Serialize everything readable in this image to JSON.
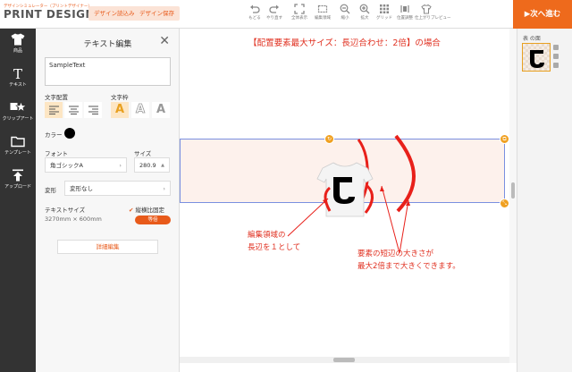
{
  "app": {
    "logo_sub": "デザインシミュレーター（プリントデザイナー）",
    "logo_main": "PRINT DESIGNER",
    "load_design": "デザイン読込み",
    "save_design": "デザイン保存",
    "next_button": "▶次へ進む"
  },
  "toolbar": {
    "undo": "もどる",
    "redo": "やり直す",
    "fit_all": "全体表示",
    "edit_area": "編集領域",
    "zoom_out": "縮小",
    "zoom_in": "拡大",
    "grid": "グリッド",
    "align_tool": "位置調整",
    "preview": "仕上がりプレビュー"
  },
  "sidebar": {
    "items": [
      {
        "label": "商品",
        "icon": "tshirt-icon"
      },
      {
        "label": "テキスト",
        "icon": "text-icon"
      },
      {
        "label": "クリップアート",
        "icon": "clipart-icon"
      },
      {
        "label": "テンプレート",
        "icon": "folder-icon"
      },
      {
        "label": "アップロード",
        "icon": "upload-icon"
      }
    ]
  },
  "panel": {
    "title": "テキスト編集",
    "text_value": "SampleText",
    "text_align_label": "文字配置",
    "text_frame_label": "文字枠",
    "color_label": "カラー",
    "font_label": "フォント",
    "font_value": "角ゴシックA",
    "size_label": "サイズ",
    "size_value": "280.9",
    "transform_label": "変形",
    "transform_value": "変形なし",
    "text_size_label": "テキストサイズ",
    "text_size_value": "3270mm × 600mm",
    "keep_ratio_label": "縦横比固定",
    "ratio_badge": "等倍",
    "detail_button": "詳細編集",
    "text_color": "#000000"
  },
  "canvas": {
    "heading": "【配置要素最大サイズ：長辺合わせ：2倍】の場合",
    "note_left": [
      "編集領域の",
      "長辺を１として"
    ],
    "note_right": [
      "要素の短辺の大きさが",
      "最大2倍まで大きくできます。"
    ],
    "accent_color": "#e03020"
  },
  "right_panel": {
    "tab_label": "表 の面"
  }
}
